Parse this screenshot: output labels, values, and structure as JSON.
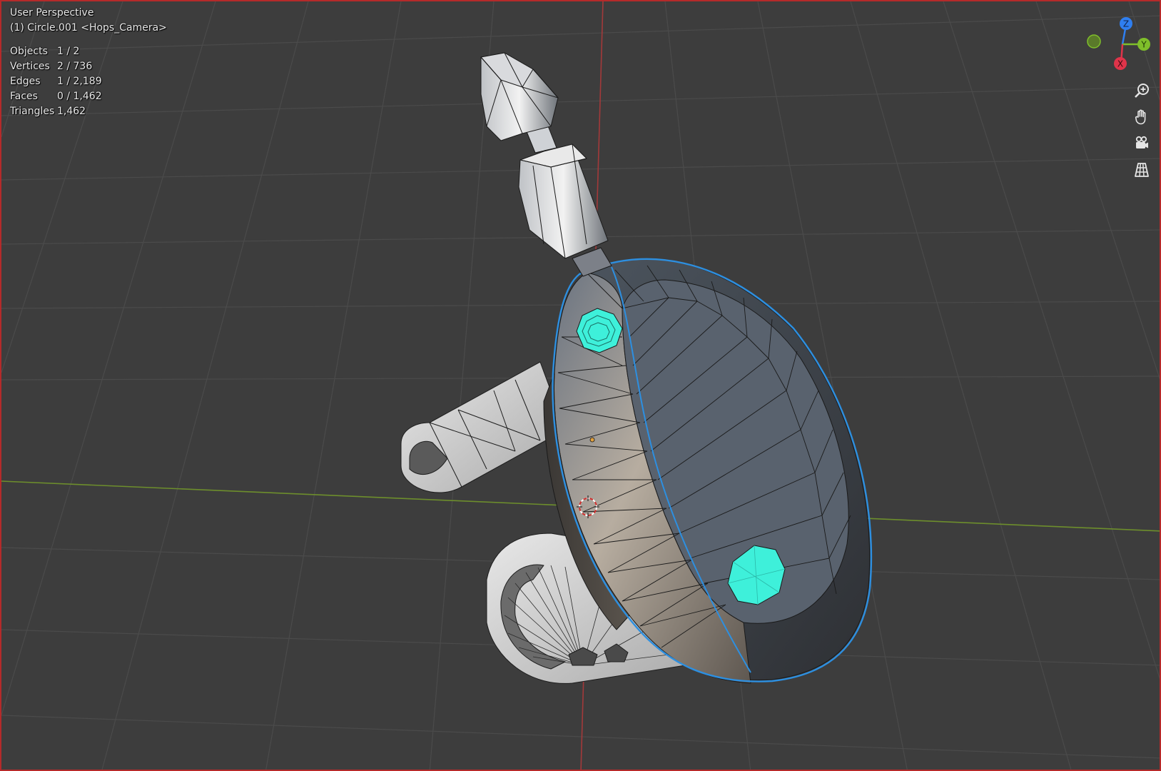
{
  "viewport": {
    "view_name": "User Perspective",
    "object_line": "(1) Circle.001 <Hops_Camera>",
    "stats": [
      {
        "label": "Objects",
        "value": "1 / 2"
      },
      {
        "label": "Vertices",
        "value": "2 / 736"
      },
      {
        "label": "Edges",
        "value": "1 / 2,189"
      },
      {
        "label": "Faces",
        "value": "0 / 1,462"
      },
      {
        "label": "Triangles",
        "value": "1,462"
      }
    ]
  },
  "gizmo": {
    "z_label": "Z",
    "y_label": "Y",
    "x_label": "X",
    "colors": {
      "z": "#2f7ff0",
      "y": "#7fbf2a",
      "x": "#e0344a",
      "neg_y": "#5a7a2a"
    }
  },
  "nav_tools": [
    {
      "name": "zoom-icon"
    },
    {
      "name": "pan-hand-icon"
    },
    {
      "name": "camera-icon"
    },
    {
      "name": "ortho-grid-icon"
    }
  ],
  "colors": {
    "background": "#3d3d3d",
    "grid": "#4a4a4a",
    "x_axis": "#a3393a",
    "y_axis": "#6d8e2c",
    "selection_outline": "#2d8fe0",
    "lens": "#3ef0da",
    "frame_border": "#b52a2a"
  }
}
